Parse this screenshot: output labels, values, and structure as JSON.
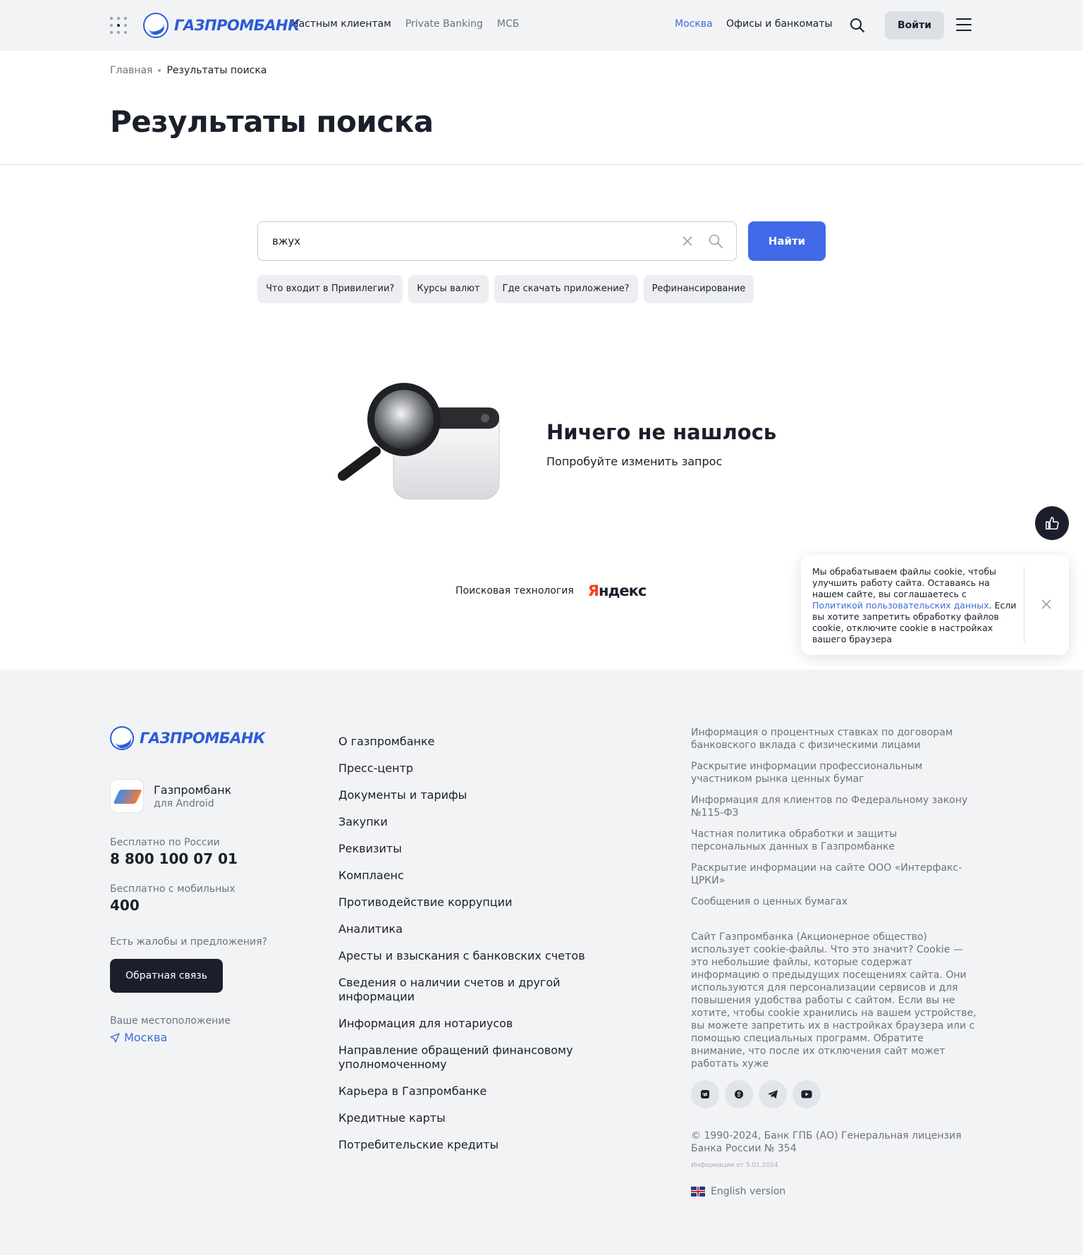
{
  "header": {
    "logo_text": "ГАЗПРОМБАНК",
    "nav": [
      "Частным клиентам",
      "Private Banking",
      "МСБ"
    ],
    "city": "Москва",
    "offices": "Офисы и банкоматы",
    "login": "Войти"
  },
  "breadcrumb": {
    "home": "Главная",
    "current": "Результаты поиска"
  },
  "page_title": "Результаты поиска",
  "search": {
    "value": "вжух",
    "button": "Найти",
    "chips": [
      "Что входит в Привилегии?",
      "Курсы валют",
      "Где скачать приложение?",
      "Рефинансирование"
    ]
  },
  "empty_state": {
    "title": "Ничего не нашлось",
    "subtitle": "Попробуйте изменить запрос"
  },
  "yandex": {
    "label": "Поисковая технология",
    "logo_first": "Я",
    "logo_rest": "ндекс"
  },
  "cookie_banner": {
    "text_before": "Мы обрабатываем файлы cookie, чтобы улучшить работу сайта. Оставаясь на нашем сайте, вы соглашаетесь с ",
    "link": "Политикой пользовательских данных",
    "text_after": ". Если вы хотите запретить обработку файлов cookie, отключите cookie в настройках вашего браузера"
  },
  "footer": {
    "logo_text": "ГАЗПРОМБАНК",
    "app_title": "Газпромбанк",
    "app_sub": "для Android",
    "free_russia_label": "Бесплатно по России",
    "free_russia_phone": "8 800 100 07 01",
    "free_mobile_label": "Бесплатно с мобильных",
    "free_mobile_phone": "400",
    "complaints_label": "Есть жалобы и предложения?",
    "feedback_button": "Обратная связь",
    "location_label": "Ваше местоположение",
    "location_city": "Москва",
    "links": [
      "О газпромбанке",
      "Пресс-центр",
      "Документы и тарифы",
      "Закупки",
      "Реквизиты",
      "Комплаенс",
      "Противодействие коррупции",
      "Аналитика",
      "Аресты и взыскания с банковских счетов",
      "Сведения о наличии счетов и другой информации",
      "Информация для нотариусов",
      "Направление обращений финансовому уполномоченному",
      "Карьера в Газпромбанке",
      "Кредитные карты",
      "Потребительские кредиты"
    ],
    "info_links": [
      "Информация о процентных ставках по договорам банковского вклада с физическими лицами",
      "Раскрытие информации профессиональным участником рынка ценных бумаг",
      "Информация для клиентов по Федеральному закону №115-ФЗ",
      "Частная политика обработки и защиты персональных данных в Газпромбанке",
      "Раскрытие информации на сайте ООО «Интерфакс-ЦРКИ»",
      "Сообщения о ценных бумагах"
    ],
    "cookie_text": "Сайт Газпромбанка (Акционерное общество) использует cookie-файлы. Что это значит? Cookie — это небольшие файлы, которые содержат информацию о предыдущих посещениях сайта. Они используются для персонализации сервисов и для повышения удобства работы с сайтом. Если вы не хотите, чтобы cookie хранились на вашем устройстве, вы можете запретить их в настройках браузера или с помощью специальных программ. Обратите внимание, что после их отключения сайт может работать хуже",
    "socials": [
      "vk-icon",
      "ok-icon",
      "telegram-icon",
      "youtube-icon"
    ],
    "copyright": "© 1990-2024, Банк ГПБ (АО) Генеральная лицензия Банка России № 354",
    "info_date": "Информация от 5.01.2024",
    "english": "English version"
  }
}
